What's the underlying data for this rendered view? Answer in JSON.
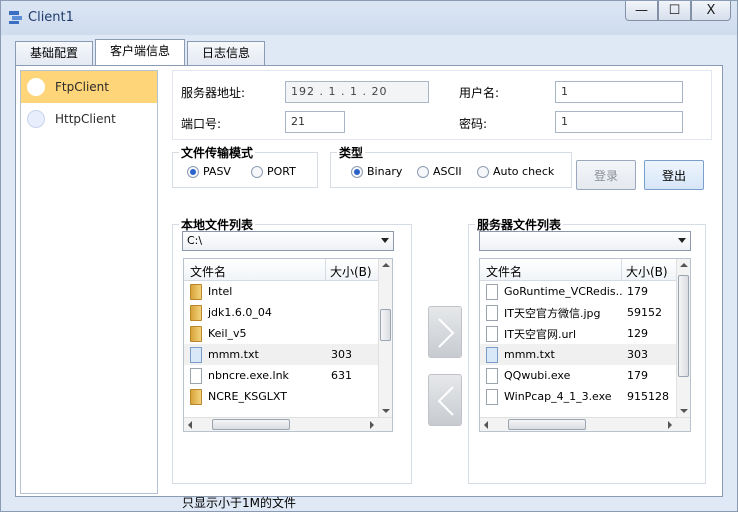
{
  "window": {
    "title": "Client1",
    "controls": {
      "minimize": "—",
      "maximize": "☐",
      "close": "X"
    }
  },
  "tabs": [
    {
      "label": "基础配置"
    },
    {
      "label": "客户端信息"
    },
    {
      "label": "日志信息"
    }
  ],
  "sidebar": {
    "items": [
      {
        "label": "FtpClient"
      },
      {
        "label": "HttpClient"
      }
    ]
  },
  "server": {
    "address_label": "服务器地址:",
    "address_value": "192 . 1 . 1 . 20",
    "port_label": "端口号:",
    "port_value": "21",
    "username_label": "用户名:",
    "username_value": "1",
    "password_label": "密码:",
    "password_value": "1"
  },
  "transfer_mode": {
    "title": "文件传输模式",
    "options": [
      {
        "label": "PASV",
        "selected": true
      },
      {
        "label": "PORT",
        "selected": false
      }
    ]
  },
  "type_group": {
    "title": "类型",
    "options": [
      {
        "label": "Binary",
        "selected": true
      },
      {
        "label": "ASCII",
        "selected": false
      },
      {
        "label": "Auto check",
        "selected": false
      }
    ]
  },
  "buttons": {
    "login": "登录",
    "logout": "登出"
  },
  "local": {
    "title": "本地文件列表",
    "path": "C:\\",
    "col_name": "文件名",
    "col_size": "大小(B)",
    "files": [
      {
        "name": "Intel",
        "size": "",
        "icon": "folder-icon"
      },
      {
        "name": "jdk1.6.0_04",
        "size": "",
        "icon": "folder-icon"
      },
      {
        "name": "Keil_v5",
        "size": "",
        "icon": "folder-icon"
      },
      {
        "name": "mmm.txt",
        "size": "303",
        "icon": "text-file-icon"
      },
      {
        "name": "nbncre.exe.lnk",
        "size": "631",
        "icon": "file-icon"
      },
      {
        "name": "NCRE_KSGLXT",
        "size": "",
        "icon": "folder-icon"
      }
    ]
  },
  "remote": {
    "title": "服务器文件列表",
    "path": "",
    "col_name": "文件名",
    "col_size": "大小(B)",
    "files": [
      {
        "name": "GoRuntime_VCRedis...",
        "size": "179",
        "icon": "file-icon"
      },
      {
        "name": "IT天空官方微信.jpg",
        "size": "59152",
        "icon": "file-icon"
      },
      {
        "name": "IT天空官网.url",
        "size": "129",
        "icon": "file-icon"
      },
      {
        "name": "mmm.txt",
        "size": "303",
        "icon": "text-file-icon"
      },
      {
        "name": "QQwubi.exe",
        "size": "179",
        "icon": "file-icon"
      },
      {
        "name": "WinPcap_4_1_3.exe",
        "size": "915128",
        "icon": "file-icon"
      }
    ]
  },
  "note": "只显示小于1M的文件"
}
